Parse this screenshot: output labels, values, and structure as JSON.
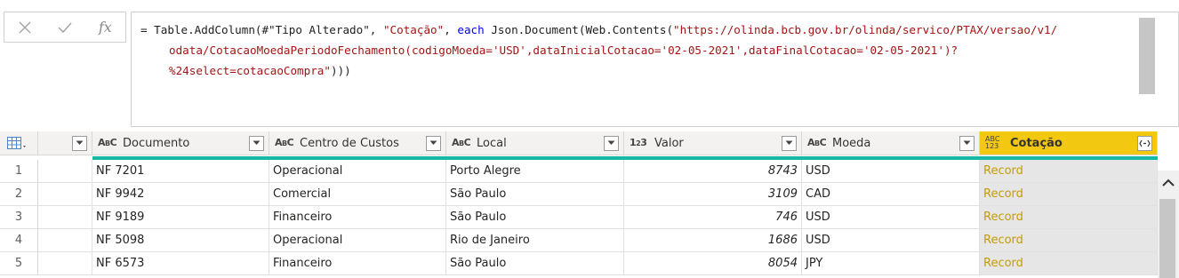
{
  "formula_bar": {
    "cancel_icon": "close-icon",
    "confirm_icon": "check-icon",
    "fx_label": "fx",
    "lines": [
      [
        {
          "t": "= Table.AddColumn(#\"Tipo Alterado\", ",
          "c": "plain"
        },
        {
          "t": "\"Cotação\"",
          "c": "str"
        },
        {
          "t": ", ",
          "c": "plain"
        },
        {
          "t": "each",
          "c": "kw"
        },
        {
          "t": " Json.Document(Web.Contents(",
          "c": "plain"
        },
        {
          "t": "\"https://olinda.bcb.gov.br/olinda/servico/PTAX/versao/v1/",
          "c": "str"
        }
      ],
      [
        {
          "t": "odata/CotacaoMoedaPeriodoFechamento(codigoMoeda='USD',dataInicialCotacao='02-05-2021',dataFinalCotacao='02-05-2021')?",
          "c": "str"
        }
      ],
      [
        {
          "t": "%24select=cotacaoCompra\"",
          "c": "str"
        },
        {
          "t": ")))",
          "c": "plain"
        }
      ]
    ]
  },
  "table": {
    "columns": [
      {
        "name": "",
        "type": ""
      },
      {
        "name": "Documento",
        "type": "ABC"
      },
      {
        "name": "Centro de Custos",
        "type": "ABC"
      },
      {
        "name": "Local",
        "type": "ABC"
      },
      {
        "name": "Valor",
        "type": "123"
      },
      {
        "name": "Moeda",
        "type": "ABC"
      },
      {
        "name": "Cotação",
        "type": "ABC123"
      }
    ],
    "rows": [
      {
        "n": "1",
        "documento": "NF 7201",
        "centro": "Operacional",
        "local": "Porto Alegre",
        "valor": "8743",
        "moeda": "USD",
        "cotacao": "Record"
      },
      {
        "n": "2",
        "documento": "NF 9942",
        "centro": "Comercial",
        "local": "São Paulo",
        "valor": "3109",
        "moeda": "CAD",
        "cotacao": "Record"
      },
      {
        "n": "3",
        "documento": "NF 9189",
        "centro": "Financeiro",
        "local": "São Paulo",
        "valor": "746",
        "moeda": "USD",
        "cotacao": "Record"
      },
      {
        "n": "4",
        "documento": "NF 5098",
        "centro": "Operacional",
        "local": "Rio de Janeiro",
        "valor": "1686",
        "moeda": "USD",
        "cotacao": "Record"
      },
      {
        "n": "5",
        "documento": "NF 6573",
        "centro": "Financeiro",
        "local": "São Paulo",
        "valor": "8054",
        "moeda": "JPY",
        "cotacao": "Record"
      }
    ]
  },
  "colors": {
    "selected_header": "#f2c811",
    "quality_bar": "#17b8a6",
    "record_text": "#c29c08",
    "string_literal": "#a31515",
    "keyword": "#0000ff"
  }
}
